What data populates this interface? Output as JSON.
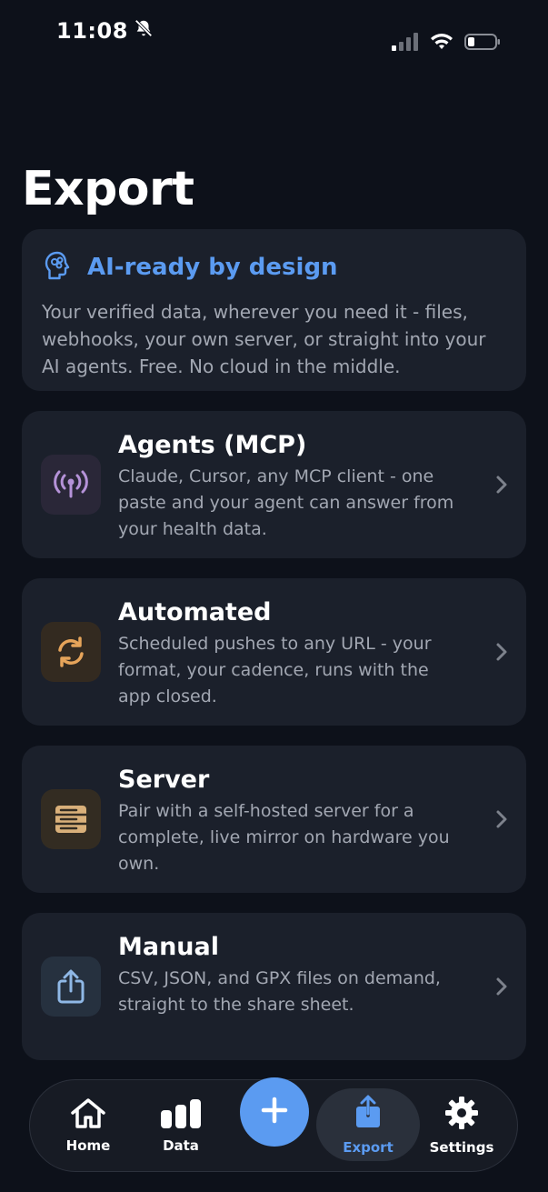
{
  "status": {
    "time": "11:08",
    "icons": [
      "bell-slash-icon",
      "signal-icon",
      "wifi-icon",
      "battery-icon"
    ]
  },
  "page": {
    "title": "Export"
  },
  "hero": {
    "icon": "brain-head-icon",
    "title": "AI-ready by design",
    "body": "Your verified data, wherever you need it - files, webhooks, your own server, or straight into your AI agents. Free. No cloud in the middle."
  },
  "options": [
    {
      "title": "Agents (MCP)",
      "desc": "Claude, Cursor, any MCP client - one paste and your agent can answer from your health data.",
      "icon": "antenna-icon",
      "color": "#b592d8"
    },
    {
      "title": "Automated",
      "desc": "Scheduled pushes to any URL - your format, your cadence, runs with the app closed.",
      "icon": "sync-icon",
      "color": "#e6a45a"
    },
    {
      "title": "Server",
      "desc": "Pair with a self-hosted server for a complete, live mirror on hardware you own.",
      "icon": "server-icon",
      "color": "#d9b07a"
    },
    {
      "title": "Manual",
      "desc": "CSV, JSON, and GPX files on demand, straight to the share sheet.",
      "icon": "share-icon",
      "color": "#8fb8e6"
    }
  ],
  "tabbar": {
    "tabs": [
      {
        "label": "Home",
        "icon": "home-icon"
      },
      {
        "label": "Data",
        "icon": "bar-chart-icon"
      },
      {
        "label": "Export",
        "icon": "share-icon",
        "active": true
      },
      {
        "label": "Settings",
        "icon": "gear-icon"
      }
    ],
    "add_icon": "plus-icon"
  },
  "colors": {
    "background": "#0d111a",
    "card": "#1b202b",
    "accent": "#5b9bf1",
    "muted_text": "#a2a7b2"
  }
}
